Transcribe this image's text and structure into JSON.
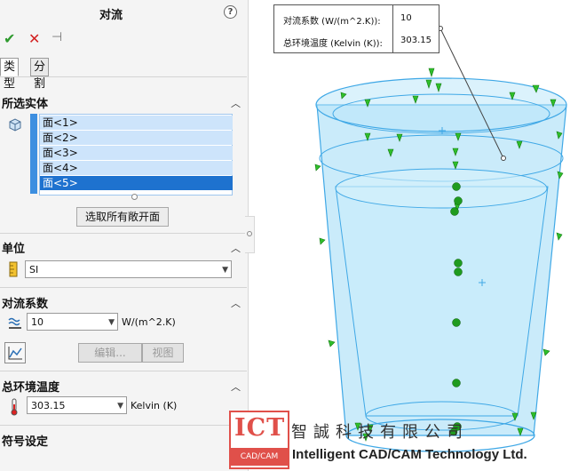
{
  "panel": {
    "title": "对流",
    "help_glyph": "?",
    "ok_glyph": "✔",
    "cancel_glyph": "✕",
    "pin_glyph": "⊣",
    "tabs": [
      {
        "label": "类型"
      },
      {
        "label": "分割"
      }
    ],
    "selected_entities": {
      "header": "所选实体",
      "faces": [
        "面<1>",
        "面<2>",
        "面<3>",
        "面<4>",
        "面<5>"
      ],
      "selected_index": 4,
      "select_open_faces_label": "选取所有敞开面"
    },
    "units": {
      "header": "单位",
      "system": "SI"
    },
    "convection_coefficient": {
      "header": "对流系数",
      "value": "10",
      "unit": "W/(m^2.K)",
      "edit_label": "编辑...",
      "view_label": "视图"
    },
    "ambient_temperature": {
      "header": "总环境温度",
      "value": "303.15",
      "unit": "Kelvin (K)"
    },
    "symbol_settings": {
      "header": "符号设定"
    }
  },
  "callout": {
    "coef_label": "对流系数 (W/(m^2.K)):",
    "coef_value": "10",
    "temp_label": "总环境温度 (Kelvin (K)):",
    "temp_value": "303.15"
  },
  "watermark": {
    "logo_main": "ICT",
    "logo_sub": "CAD/CAM",
    "chinese_name": "智誠科技有限公司",
    "english_name": "Intelligent CAD/CAM Technology Ltd."
  },
  "colors": {
    "selection_blue": "#1e72cf",
    "list_blue": "#cde4fb",
    "arrow_green": "#2fbf2a",
    "cup_blue": "#8ed0f4",
    "logo_red": "#e0504a"
  }
}
